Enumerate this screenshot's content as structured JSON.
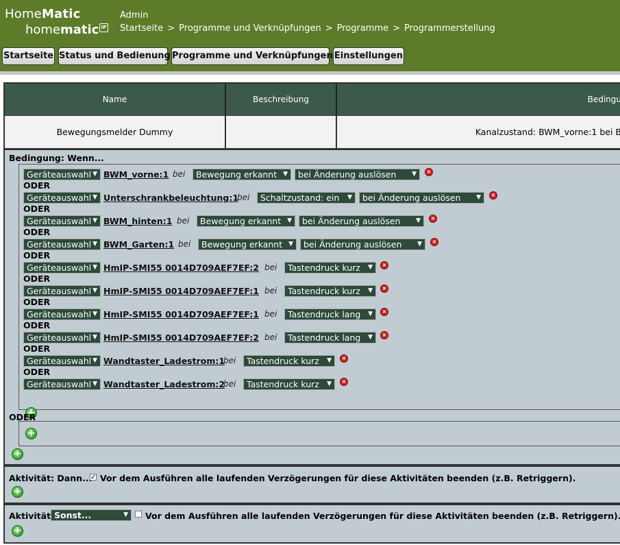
{
  "brand": {
    "line1_prefix": "Home",
    "line1_bold": "Matic",
    "line2_prefix": "home",
    "line2_bold": "matic",
    "badge": "IP"
  },
  "header": {
    "user": "Admin",
    "breadcrumb": [
      "Startseite",
      "Programme und Verknüpfungen",
      "Programme",
      "Programmerstellung"
    ],
    "breadcrumb_sep": ">"
  },
  "nav": [
    "Startseite",
    "Status und Bedienung",
    "Programme und Verknüpfungen",
    "Einstellungen"
  ],
  "table": {
    "headers": [
      "Name",
      "Beschreibung",
      "Bedingu"
    ],
    "row": [
      "Bewegungsmelder Dummy",
      "",
      "Kanalzustand: BWM_vorne:1 bei B"
    ]
  },
  "condition": {
    "title": "Bedingung: Wenn...",
    "or_label": "ODER",
    "bei": "bei",
    "rows": [
      {
        "selector": "Geräteauswahl",
        "device": "BWM_vorne:1",
        "state": "Bewegung erkannt",
        "trigger": "bei Änderung auslösen"
      },
      {
        "selector": "Geräteauswahl",
        "device": "Unterschrankbeleuchtung:1",
        "state": "Schaltzustand: ein",
        "trigger": "bei Änderung auslösen"
      },
      {
        "selector": "Geräteauswahl",
        "device": "BWM_hinten:1",
        "state": "Bewegung erkannt",
        "trigger": "bei Änderung auslösen"
      },
      {
        "selector": "Geräteauswahl",
        "device": "BWM_Garten:1",
        "state": "Bewegung erkannt",
        "trigger": "bei Änderung auslösen"
      },
      {
        "selector": "Geräteauswahl",
        "device": "HmIP-SMI55 0014D709AEF7EF:2",
        "state": "Tastendruck kurz",
        "trigger": ""
      },
      {
        "selector": "Geräteauswahl",
        "device": "HmIP-SMI55 0014D709AEF7EF:1",
        "state": "Tastendruck kurz",
        "trigger": ""
      },
      {
        "selector": "Geräteauswahl",
        "device": "HmIP-SMI55 0014D709AEF7EF:1",
        "state": "Tastendruck lang",
        "trigger": ""
      },
      {
        "selector": "Geräteauswahl",
        "device": "HmIP-SMI55 0014D709AEF7EF:2",
        "state": "Tastendruck lang",
        "trigger": ""
      },
      {
        "selector": "Geräteauswahl",
        "device": "Wandtaster_Ladestrom:1",
        "state": "Tastendruck kurz",
        "trigger": ""
      },
      {
        "selector": "Geräteauswahl",
        "device": "Wandtaster_Ladestrom:2",
        "state": "Tastendruck kurz",
        "trigger": ""
      }
    ],
    "or_block_label": "ODER"
  },
  "activity_then": {
    "label": "Aktivität: Dann...",
    "checked": true,
    "text": "Vor dem Ausführen alle laufenden Verzögerungen für diese Aktivitäten beenden (z.B. Retriggern)."
  },
  "activity_else": {
    "label": "Aktivität:",
    "select": "Sonst...",
    "checked": false,
    "text": "Vor dem Ausführen alle laufenden Verzögerungen für diese Aktivitäten beenden (z.B. Retriggern)."
  },
  "icons": {
    "delete": "delete-icon",
    "add": "add-icon",
    "dropdown": "chevron-down-icon",
    "check": "checkmark-icon"
  },
  "colors": {
    "header_bg": "#5d7b29",
    "table_header_bg": "#3c5a49",
    "panel_bg": "#c0ccd2",
    "select_bg": "#2d4a3b",
    "delete": "#cc2020",
    "add": "#1d8a1d"
  }
}
